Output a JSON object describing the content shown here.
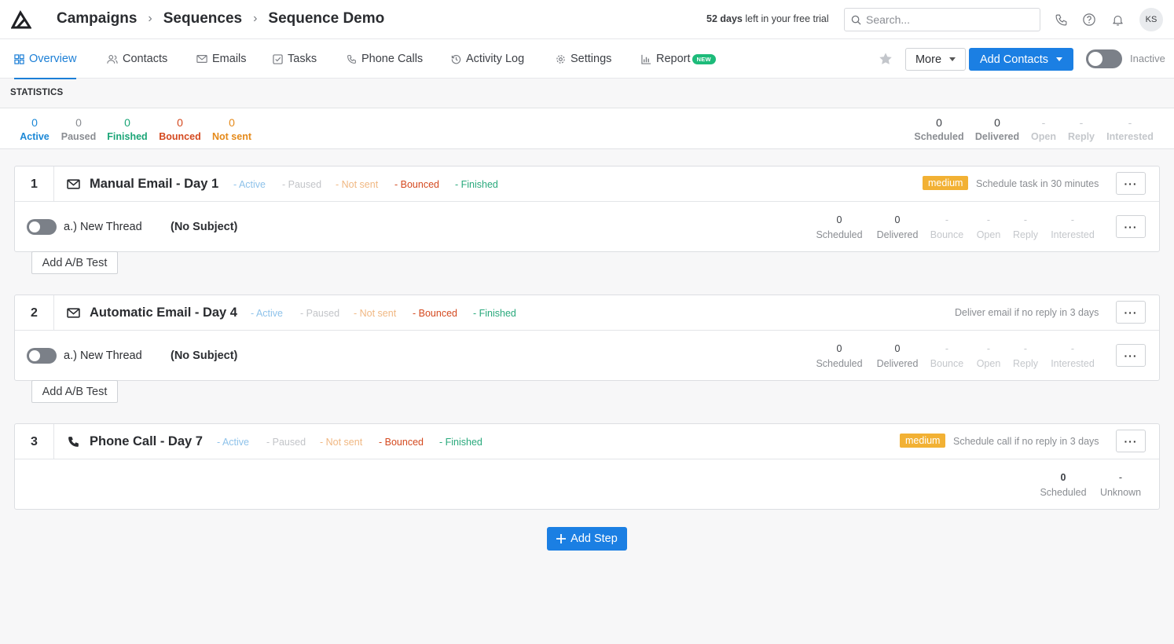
{
  "header": {
    "breadcrumb": [
      "Campaigns",
      "Sequences",
      "Sequence Demo"
    ],
    "trial_days": "52 days",
    "trial_text": " left in your free trial",
    "search_placeholder": "Search...",
    "avatar_initials": "KS"
  },
  "tabs": [
    {
      "label": "Overview",
      "icon": "grid-icon",
      "active": true
    },
    {
      "label": "Contacts",
      "icon": "users-icon"
    },
    {
      "label": "Emails",
      "icon": "mail-icon"
    },
    {
      "label": "Tasks",
      "icon": "check-square-icon"
    },
    {
      "label": "Phone Calls",
      "icon": "phone-icon"
    },
    {
      "label": "Activity Log",
      "icon": "history-icon"
    },
    {
      "label": "Settings",
      "icon": "gear-icon"
    },
    {
      "label": "Report",
      "icon": "bar-chart-icon",
      "badge": "NEW"
    }
  ],
  "toolbar": {
    "more_label": "More",
    "add_contacts_label": "Add Contacts",
    "status_label": "Inactive"
  },
  "statistics": {
    "title": "STATISTICS",
    "left": [
      {
        "value": "0",
        "label": "Active"
      },
      {
        "value": "0",
        "label": "Paused"
      },
      {
        "value": "0",
        "label": "Finished"
      },
      {
        "value": "0",
        "label": "Bounced"
      },
      {
        "value": "0",
        "label": "Not sent"
      }
    ],
    "right": [
      {
        "value": "0",
        "label": "Scheduled"
      },
      {
        "value": "0",
        "label": "Delivered"
      },
      {
        "value": "-",
        "label": "Open"
      },
      {
        "value": "-",
        "label": "Reply"
      },
      {
        "value": "-",
        "label": "Interested"
      }
    ]
  },
  "steps": [
    {
      "number": "1",
      "title": "Manual Email - Day 1",
      "statuses": [
        "- Active",
        "- Paused",
        "- Not sent",
        "- Bounced",
        "- Finished"
      ],
      "priority": "medium",
      "schedule": "Schedule task in 30 minutes",
      "thread": "a.) New Thread",
      "subject": "(No Subject)",
      "stats": [
        {
          "value": "0",
          "label": "Scheduled"
        },
        {
          "value": "0",
          "label": "Delivered"
        },
        {
          "value": "-",
          "label": "Bounce"
        },
        {
          "value": "-",
          "label": "Open"
        },
        {
          "value": "-",
          "label": "Reply"
        },
        {
          "value": "-",
          "label": "Interested"
        }
      ],
      "ab_label": "Add A/B Test"
    },
    {
      "number": "2",
      "title": "Automatic Email - Day 4",
      "statuses": [
        "- Active",
        "- Paused",
        "- Not sent",
        "- Bounced",
        "- Finished"
      ],
      "schedule": "Deliver email if no reply in 3 days",
      "thread": "a.) New Thread",
      "subject": "(No Subject)",
      "stats": [
        {
          "value": "0",
          "label": "Scheduled"
        },
        {
          "value": "0",
          "label": "Delivered"
        },
        {
          "value": "-",
          "label": "Bounce"
        },
        {
          "value": "-",
          "label": "Open"
        },
        {
          "value": "-",
          "label": "Reply"
        },
        {
          "value": "-",
          "label": "Interested"
        }
      ],
      "ab_label": "Add A/B Test"
    },
    {
      "number": "3",
      "title": "Phone Call - Day 7",
      "statuses": [
        "- Active",
        "- Paused",
        "- Not sent",
        "- Bounced",
        "- Finished"
      ],
      "priority": "medium",
      "schedule": "Schedule call if no reply in 3 days",
      "stats": [
        {
          "value": "0",
          "label": "Scheduled"
        },
        {
          "value": "-",
          "label": "Unknown"
        }
      ]
    }
  ],
  "add_step_label": "Add Step",
  "menu_dots": "···"
}
